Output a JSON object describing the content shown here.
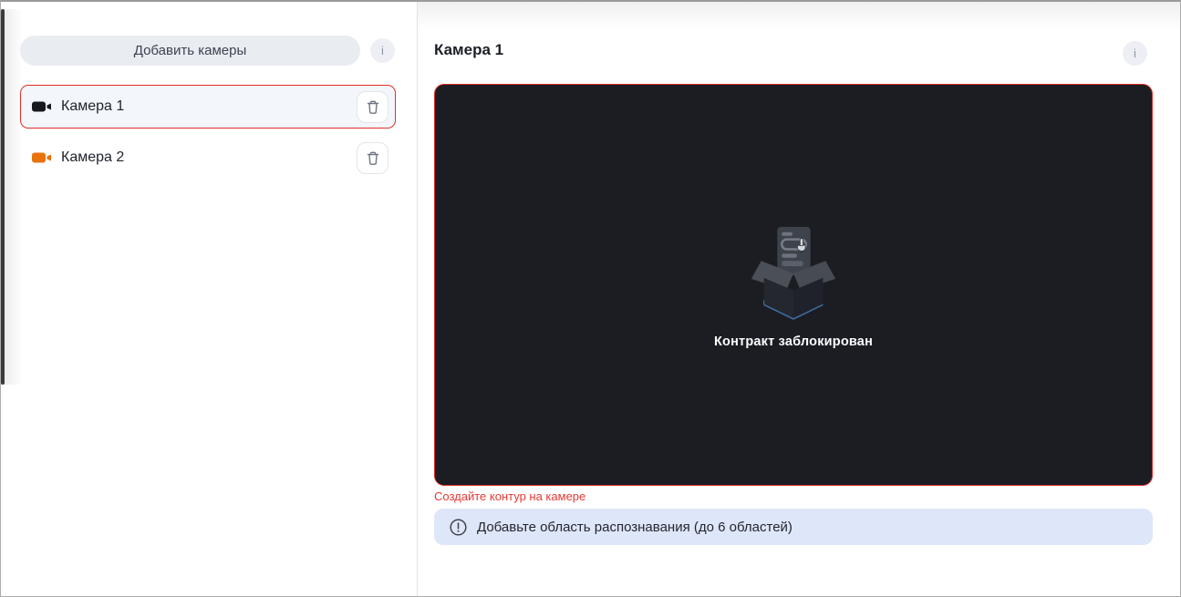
{
  "sidebar": {
    "add_button_label": "Добавить камеры",
    "add_info_icon": "i",
    "cameras": [
      {
        "label": "Камера 1",
        "selected": true,
        "icon_color": "#17191f"
      },
      {
        "label": "Камера 2",
        "selected": false,
        "icon_color": "#e8730c"
      }
    ]
  },
  "main": {
    "title": "Камера 1",
    "info_icon": "i",
    "placeholder_caption": "Контракт заблокирован",
    "error_text": "Создайте контур на камере",
    "banner_text": "Добавьте область распознавания (до 6 областей)"
  },
  "colors": {
    "accent_red": "#e0312c",
    "selected_item_bg": "#f3f6fb",
    "video_bg": "#1b1d23",
    "banner_bg": "#dee6f9",
    "camera2_orange": "#e8730c",
    "button_bg": "#e9ecf1"
  }
}
